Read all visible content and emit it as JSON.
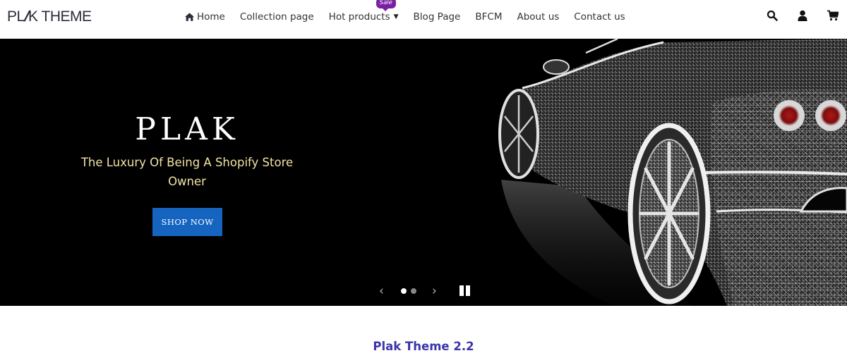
{
  "header": {
    "logo_text_a": "PL",
    "logo_text_slash": "/",
    "logo_text_b": "K THEME",
    "nav": [
      {
        "label": "Home",
        "icon": "home-icon"
      },
      {
        "label": "Collection page"
      },
      {
        "label": "Hot products",
        "badge": "Sale",
        "has_dropdown": true
      },
      {
        "label": "Blog Page"
      },
      {
        "label": "BFCM"
      },
      {
        "label": "About us"
      },
      {
        "label": "Contact us"
      }
    ],
    "icons": [
      "search-icon",
      "user-icon",
      "cart-icon"
    ]
  },
  "hero": {
    "title": "PLAK",
    "subtitle": "The Luxury Of Being A Shopify Store Owner",
    "cta_label": "SHOP NOW",
    "slides_total": 2,
    "active_slide": 1,
    "prev_arrow": "‹",
    "next_arrow": "›",
    "colors": {
      "subtitle": "#f3e3a3",
      "cta": "#1565c0"
    }
  },
  "section": {
    "title": "Plak Theme 2.2",
    "color": "#3b35a8"
  }
}
